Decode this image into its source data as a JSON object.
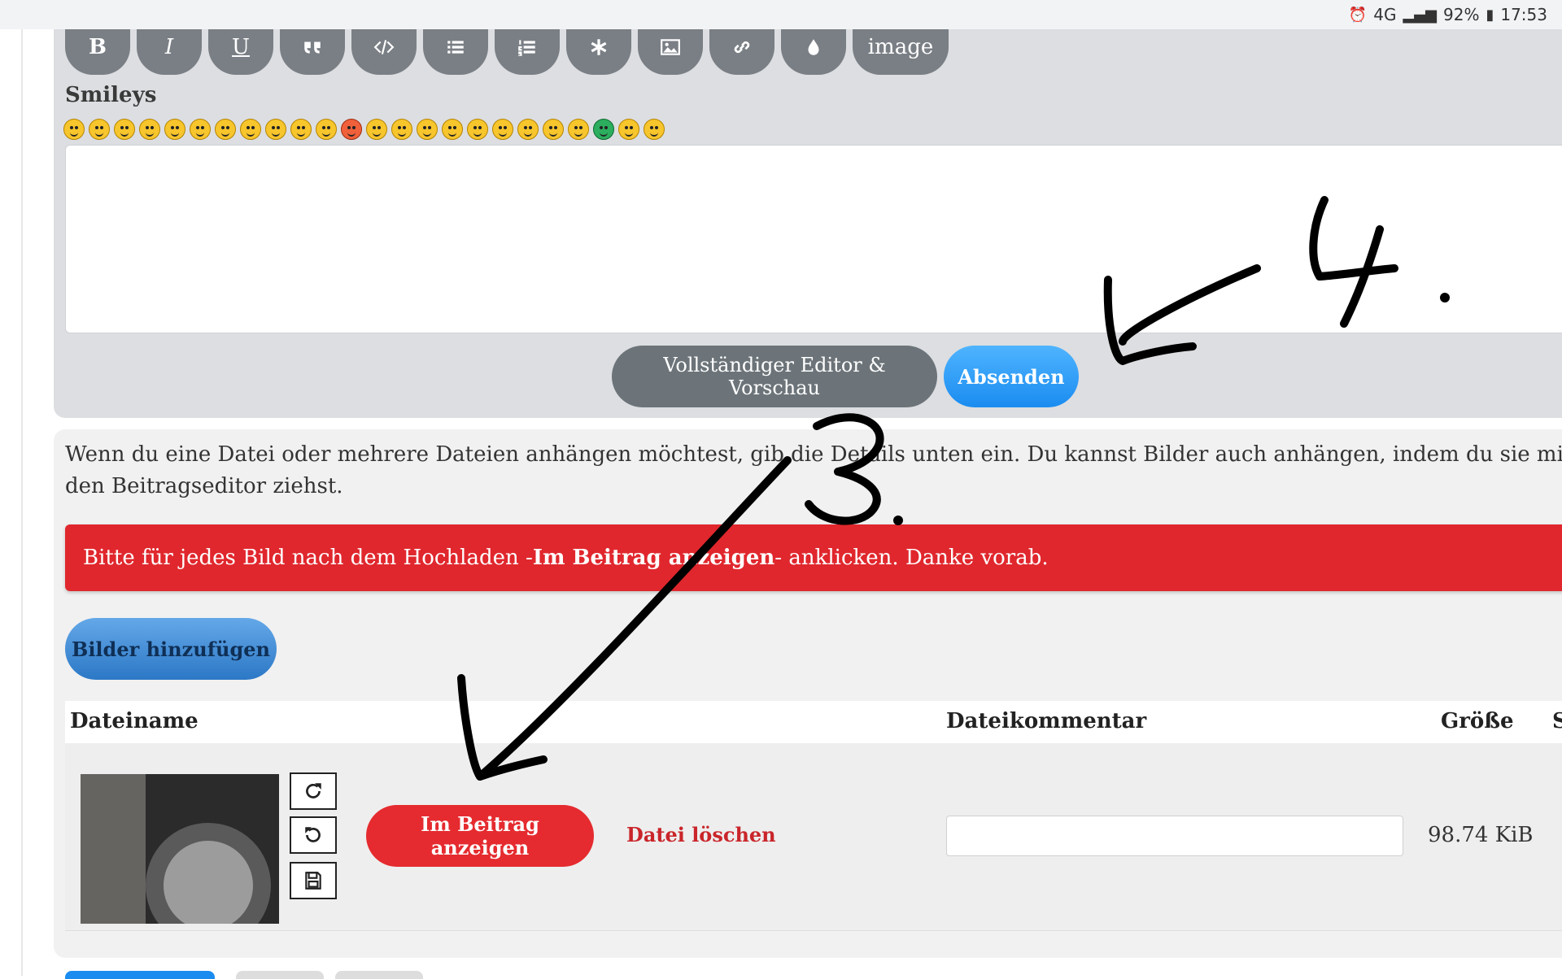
{
  "statusbar": {
    "network": "4G",
    "battery": "92%",
    "time": "17:53"
  },
  "toolbar": {
    "buttons": [
      {
        "name": "bold",
        "label": "B"
      },
      {
        "name": "italic",
        "label": "I"
      },
      {
        "name": "underline",
        "label": "U"
      },
      {
        "name": "quote",
        "icon": "quote-icon"
      },
      {
        "name": "code",
        "icon": "code-icon"
      },
      {
        "name": "list",
        "icon": "list-icon"
      },
      {
        "name": "ordered-list",
        "icon": "ordered-list-icon"
      },
      {
        "name": "list-item",
        "icon": "asterisk-icon"
      },
      {
        "name": "image-insert",
        "icon": "image-icon"
      },
      {
        "name": "link",
        "icon": "link-icon"
      },
      {
        "name": "color",
        "icon": "drop-icon"
      },
      {
        "name": "image-text",
        "label": "image"
      }
    ]
  },
  "smileys": {
    "title": "Smileys",
    "count": 24
  },
  "editor": {
    "full_editor_label": "Vollständiger Editor & Vorschau",
    "send_label": "Absenden"
  },
  "attachments": {
    "intro_line1": "Wenn du eine Datei oder mehrere Dateien anhängen möchtest, gib die Details unten ein. Du kannst Bilder auch anhängen, indem du sie mit der Maus in",
    "intro_line2": "den Beitragseditor ziehst.",
    "alert_pre": "Bitte für jedes Bild nach dem Hochladen -",
    "alert_bold": "Im Beitrag anzeigen",
    "alert_post": "- anklicken. Danke vorab.",
    "add_images_label": "Bilder hinzufügen",
    "table_headers": {
      "filename": "Dateiname",
      "comment": "Dateikommentar",
      "size": "Größe",
      "status": "S"
    },
    "files": [
      {
        "show_in_post_label": "Im Beitrag anzeigen",
        "delete_label": "Datei löschen",
        "comment": "",
        "size": "98.74 KiB"
      }
    ]
  },
  "annotations": {
    "label_3": "3.",
    "label_4": "4."
  },
  "colors": {
    "send_button": "#1a8cf0",
    "alert": "#e0272d",
    "show_button": "#e52b2f",
    "add_images": "#2c78c6",
    "toolbar_button": "#7a7f85"
  }
}
